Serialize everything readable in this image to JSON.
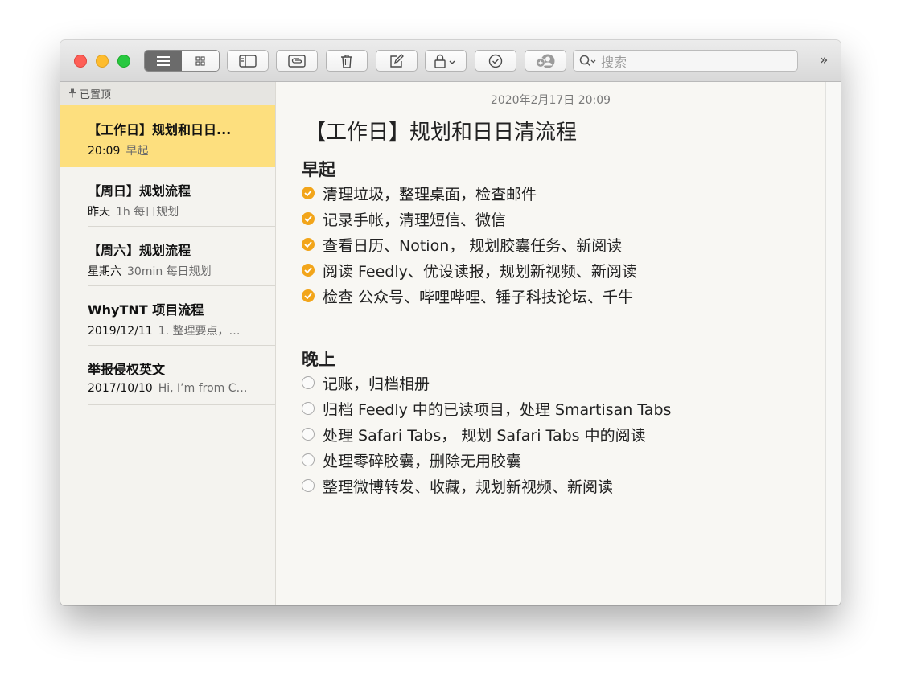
{
  "toolbar": {
    "search_placeholder": "搜索",
    "more_label": "»"
  },
  "sidebar": {
    "pinned_label": "已置顶",
    "notes": [
      {
        "title": "【工作日】规划和日日...",
        "time": "20:09",
        "preview": "早起",
        "active": true
      },
      {
        "title": "【周日】规划流程",
        "time": "昨天",
        "preview": "1h 每日规划"
      },
      {
        "title": "【周六】规划流程",
        "time": "星期六",
        "preview": "30min 每日规划"
      },
      {
        "title": "WhyTNT 项目流程",
        "time": "2019/12/11",
        "preview": "1. 整理要点，…"
      },
      {
        "title": "举报侵权英文",
        "time": "2017/10/10",
        "preview": "Hi, I’m from C…"
      }
    ]
  },
  "note": {
    "date": "2020年2月17日 20:09",
    "title": "【工作日】规划和日日清流程",
    "sections": [
      {
        "heading": "早起",
        "items": [
          {
            "text": "清理垃圾，整理桌面，检查邮件",
            "checked": true
          },
          {
            "text": "记录手帐，清理短信、微信",
            "checked": true
          },
          {
            "text": "查看日历、Notion， 规划胶囊任务、新阅读",
            "checked": true
          },
          {
            "text": "阅读 Feedly、优设读报，规划新视频、新阅读",
            "checked": true
          },
          {
            "text": "检查 公众号、哔哩哔哩、锤子科技论坛、千牛",
            "checked": true
          }
        ]
      },
      {
        "heading": "晚上",
        "items": [
          {
            "text": "记账，归档相册",
            "checked": false
          },
          {
            "text": "归档 Feedly 中的已读项目，处理 Smartisan Tabs",
            "checked": false
          },
          {
            "text": "处理 Safari Tabs， 规划 Safari Tabs 中的阅读",
            "checked": false
          },
          {
            "text": "处理零碎胶囊，删除无用胶囊",
            "checked": false
          },
          {
            "text": "整理微博转发、收藏，规划新视频、新阅读",
            "checked": false
          }
        ]
      }
    ]
  },
  "colors": {
    "accent": "#f2a51a",
    "selection": "#fddf7e"
  }
}
